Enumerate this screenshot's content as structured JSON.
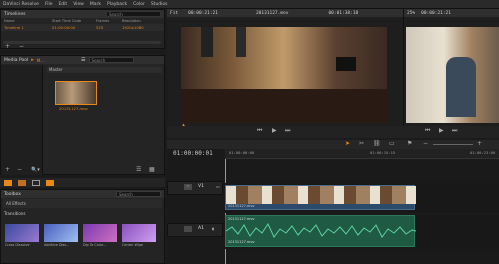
{
  "app": {
    "title": "DaVinci Resolve"
  },
  "menu": [
    "File",
    "Edit",
    "View",
    "Mark",
    "Playback",
    "Color",
    "Studios"
  ],
  "timelines": {
    "header": "Timelines",
    "search_placeholder": "Search",
    "columns": [
      "Name",
      "Start Time Code",
      "Frames",
      "Resolution"
    ],
    "rows": [
      {
        "name": "Timeline 1",
        "start": "01:00:00:00",
        "frames": "525",
        "res": "1920x1080"
      }
    ]
  },
  "media_pool": {
    "header": "Media Pool",
    "folder": "M...",
    "search_placeholder": "Search",
    "bin": "Master",
    "clip": "20131127.mov"
  },
  "toolbox": {
    "header": "Toolbox",
    "search_placeholder": "Search",
    "filter": "All Effects",
    "section": "Transitions",
    "items": [
      "Cross Dissolve",
      "Additive Diss...",
      "Dip To Color...",
      "Center Wipe"
    ]
  },
  "source": {
    "fit": "Fit",
    "tc": "00:00:21:21",
    "clip": "20131127.mov",
    "duration": "00:01:38:18"
  },
  "record": {
    "zoom": "25%",
    "tc": "00:00:21:21"
  },
  "timeline": {
    "current_tc": "01:00:00:01",
    "ruler": [
      "01:00:00:00",
      "01:00:15:15",
      "01:00:23:00"
    ],
    "video_track": "V1",
    "audio_track": "A1",
    "clip_name": "20131127.mov"
  },
  "colors": {
    "accent": "#e8881a",
    "video_clip": "#2c4a6a",
    "audio_clip": "#1f5a45"
  }
}
